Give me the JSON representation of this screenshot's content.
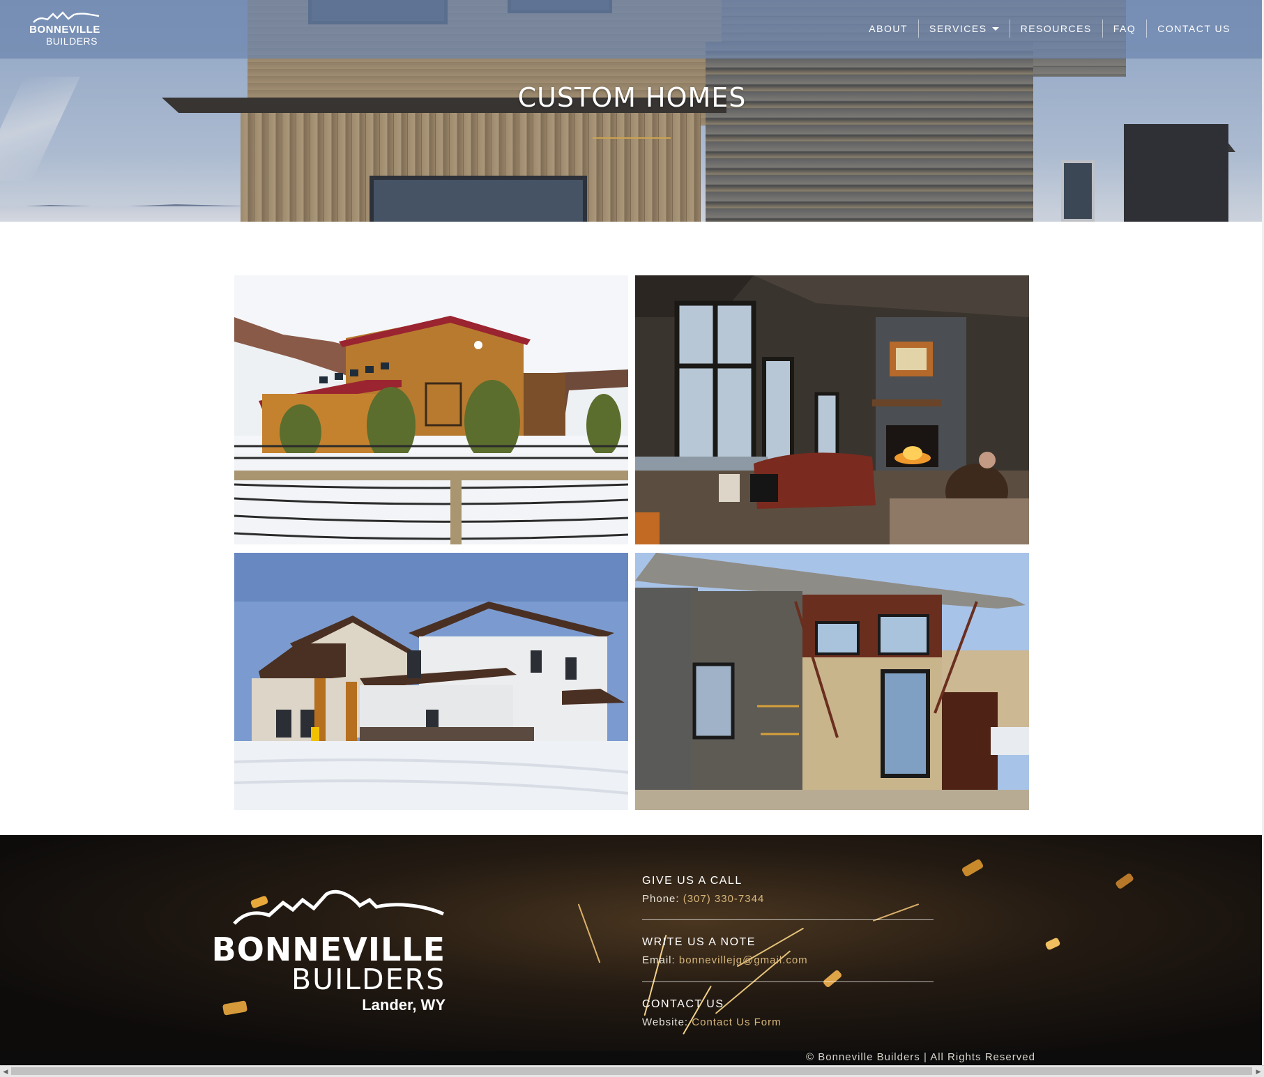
{
  "brand": {
    "name_line1": "BONNEVILLE",
    "name_line2": "BUILDERS",
    "location": "Lander, WY"
  },
  "nav": {
    "items": [
      "ABOUT",
      "SERVICES",
      "RESOURCES",
      "FAQ",
      "CONTACT US"
    ]
  },
  "hero": {
    "title": "CUSTOM HOMES"
  },
  "gallery": {
    "images": [
      "barn-with-red-roof-in-snow",
      "living-room-with-fireplace",
      "white-farmhouse-in-snow",
      "modern-reclaimed-wood-house"
    ]
  },
  "footer": {
    "call_heading": "GIVE US A CALL",
    "call_label": "Phone:",
    "call_value": "(307) 330-7344",
    "note_heading": "WRITE US A NOTE",
    "note_label": "Email:",
    "note_value": "bonnevillejg@gmail.com",
    "contact_heading": "CONTACT US",
    "contact_label": "Website:",
    "contact_value": "Contact Us Form",
    "copyright": "© Bonneville Builders | All Rights Reserved"
  },
  "colors": {
    "accent": "#caa352",
    "link": "#d6b57a",
    "nav_bg": "#6e87af"
  }
}
